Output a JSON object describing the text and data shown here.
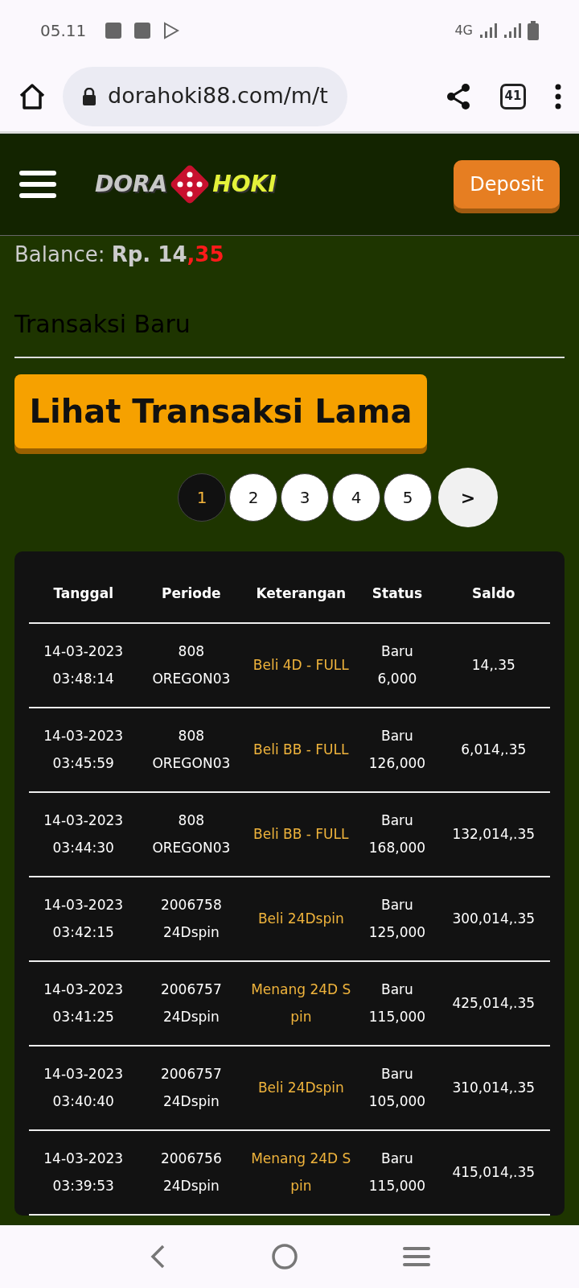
{
  "status_bar": {
    "time": "05.11",
    "network": "4G"
  },
  "browser": {
    "url": "dorahoki88.com/m/t",
    "tab_count": "41"
  },
  "header": {
    "logo_left": "DORA",
    "logo_right": "HOKI",
    "deposit_button": "Deposit"
  },
  "balance": {
    "label": "Balance:",
    "amount": "Rp. 14",
    "decimal": ",35"
  },
  "section_title": "Transaksi Baru",
  "old_transactions_button": "Lihat Transaksi Lama",
  "pagination": [
    {
      "label": "1",
      "selected": true
    },
    {
      "label": "2",
      "selected": false
    },
    {
      "label": "3",
      "selected": false
    },
    {
      "label": "4",
      "selected": false
    },
    {
      "label": "5",
      "selected": false
    }
  ],
  "next_button": ">",
  "table": {
    "columns": [
      "Tanggal",
      "Periode",
      "Keterangan",
      "Status",
      "Saldo"
    ],
    "rows": [
      {
        "date": "14-03-2023",
        "time": "03:48:14",
        "period": "808",
        "market": "OREGON03",
        "description": "Beli 4D - FULL",
        "status": "Baru",
        "amount": "6,000",
        "balance": "14,.35"
      },
      {
        "date": "14-03-2023",
        "time": "03:45:59",
        "period": "808",
        "market": "OREGON03",
        "description": "Beli BB - FULL",
        "status": "Baru",
        "amount": "126,000",
        "balance": "6,014,.35"
      },
      {
        "date": "14-03-2023",
        "time": "03:44:30",
        "period": "808",
        "market": "OREGON03",
        "description": "Beli BB - FULL",
        "status": "Baru",
        "amount": "168,000",
        "balance": "132,014,.35"
      },
      {
        "date": "14-03-2023",
        "time": "03:42:15",
        "period": "2006758",
        "market": "24Dspin",
        "description": "Beli 24Dspin",
        "status": "Baru",
        "amount": "125,000",
        "balance": "300,014,.35"
      },
      {
        "date": "14-03-2023",
        "time": "03:41:25",
        "period": "2006757",
        "market": "24Dspin",
        "description": "Menang 24D Spin",
        "status": "Baru",
        "amount": "115,000",
        "balance": "425,014,.35"
      },
      {
        "date": "14-03-2023",
        "time": "03:40:40",
        "period": "2006757",
        "market": "24Dspin",
        "description": "Beli 24Dspin",
        "status": "Baru",
        "amount": "105,000",
        "balance": "310,014,.35"
      },
      {
        "date": "14-03-2023",
        "time": "03:39:53",
        "period": "2006756",
        "market": "24Dspin",
        "description": "Menang 24D Spin",
        "status": "Baru",
        "amount": "115,000",
        "balance": "415,014,.35"
      }
    ]
  }
}
